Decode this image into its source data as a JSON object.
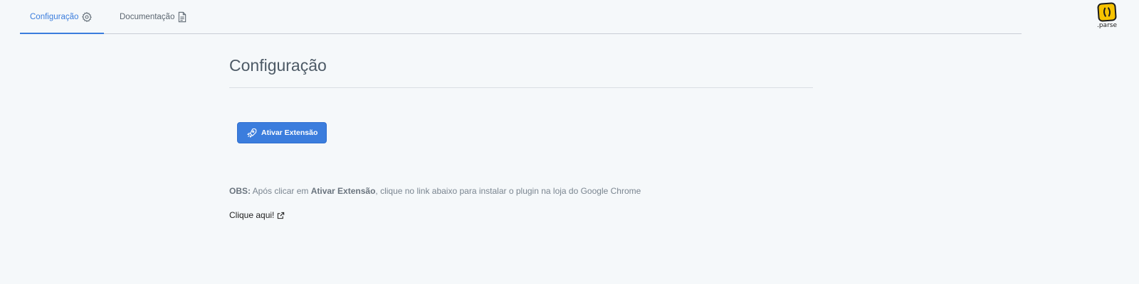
{
  "tabs": [
    {
      "label": "Configuração",
      "icon": "gear-icon",
      "active": true
    },
    {
      "label": "Documentação",
      "icon": "document-icon",
      "active": false
    }
  ],
  "logo": {
    "text": ".parse",
    "color": "#f7c300"
  },
  "main": {
    "title": "Configuração",
    "activate_button": {
      "label": "Ativar Extensão",
      "icon": "rocket-icon"
    },
    "note": {
      "prefix": "OBS:",
      "text1": " Após clicar em ",
      "emphasis": "Ativar Extensão",
      "text2": ", clique no link abaixo para instalar o plugin na loja do Google Chrome"
    },
    "link": {
      "label": "Clique aqui!",
      "icon": "external-link-icon"
    }
  },
  "colors": {
    "accent": "#3b7ddd",
    "background": "#f5f8fa"
  }
}
